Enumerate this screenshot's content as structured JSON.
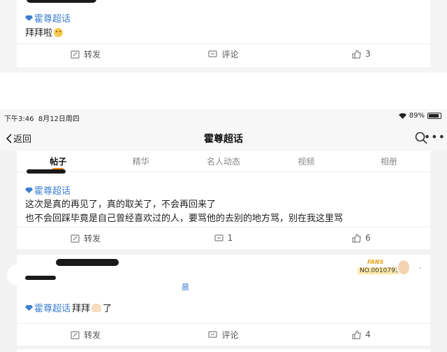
{
  "top_post": {
    "topic": "霍尊超话",
    "text": "拜拜啦",
    "actions": {
      "repost": "转发",
      "comment": "评论",
      "like": "3"
    }
  },
  "status_bar": {
    "time": "下午3:46",
    "date": "8月12日周四",
    "battery": "89%"
  },
  "nav": {
    "back": "返回",
    "title": "霍尊超话",
    "more": "•••"
  },
  "tabs": [
    {
      "label": "帖子",
      "active": true
    },
    {
      "label": "精华",
      "active": false
    },
    {
      "label": "名人动态",
      "active": false
    },
    {
      "label": "视频",
      "active": false
    },
    {
      "label": "相册",
      "active": false
    }
  ],
  "post2": {
    "topic": "霍尊超话",
    "line1": "这次是真的再见了，真的取关了，不会再回来了",
    "line2": "也不会回踩毕竟是自己曾经喜欢过的人，要骂他的去别的地方骂，别在我这里骂",
    "actions": {
      "repost": "转发",
      "comment": "1",
      "like": "6"
    }
  },
  "post3": {
    "fans_label": "FANS",
    "fans_no": "NO.0010793",
    "suffix": "晨",
    "topic": "霍尊超话",
    "text_a": "拜拜",
    "text_b": "了",
    "actions": {
      "repost": "转发",
      "comment": "评论",
      "like": "4"
    }
  },
  "colors": {
    "link_blue": "#3d7fd1",
    "tab_indicator": "#f08c1e"
  }
}
